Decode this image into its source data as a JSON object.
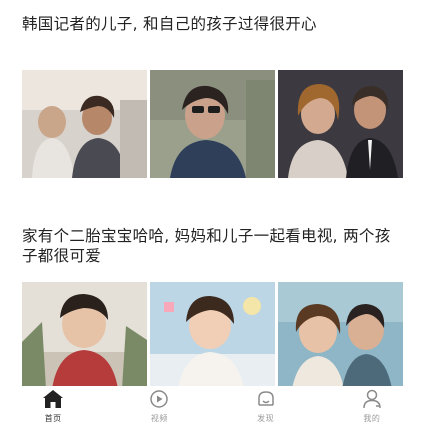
{
  "feed": {
    "items": [
      {
        "title": "韩国记者的儿子, 和自己的孩子过得很开心"
      },
      {
        "title": "家有个二胎宝宝哈哈, 妈妈和儿子一起看电视, 两个孩子都很可爱"
      }
    ]
  },
  "tab_bar": {
    "tabs": [
      {
        "label": "首页",
        "icon": "home-icon",
        "active": true
      },
      {
        "label": "视频",
        "icon": "video-play-icon",
        "active": false
      },
      {
        "label": "发现",
        "icon": "discover-icon",
        "active": false
      },
      {
        "label": "我的",
        "icon": "profile-icon",
        "active": false
      }
    ]
  },
  "colors": {
    "active_tab": "#222222",
    "inactive_tab": "#9a9a9a",
    "title_text": "#222222"
  }
}
